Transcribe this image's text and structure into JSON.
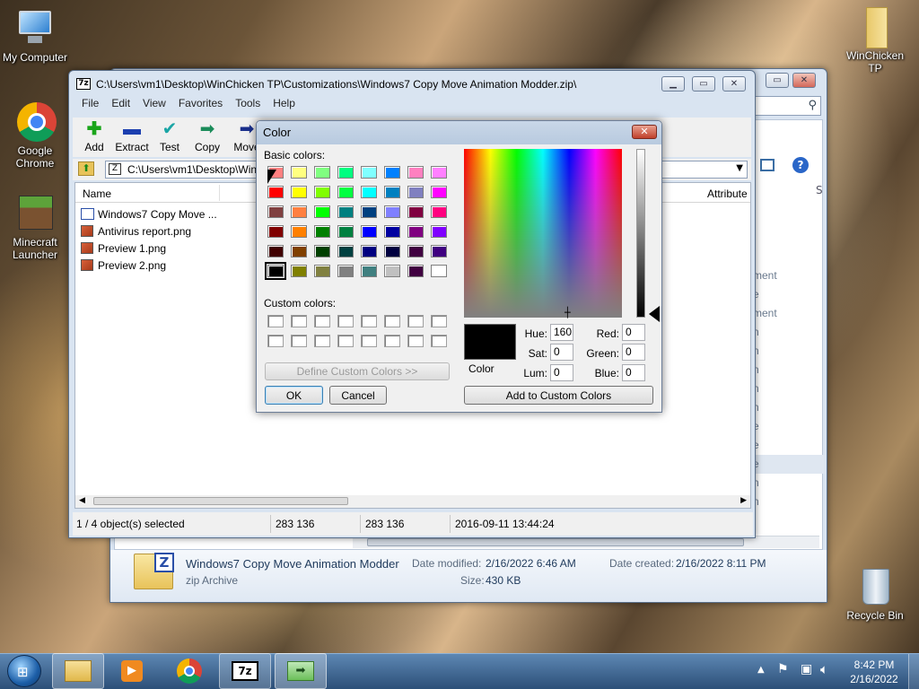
{
  "desktop": {
    "icons": [
      {
        "label": "My Computer",
        "icon": "computer-icon"
      },
      {
        "label": "Google Chrome",
        "icon": "chrome-icon"
      },
      {
        "label": "Minecraft Launcher",
        "icon": "minecraft-icon"
      },
      {
        "label": "WinChicken TP",
        "icon": "folder-zip-icon"
      },
      {
        "label": "Recycle Bin",
        "icon": "recycle-bin-icon"
      }
    ]
  },
  "sevenzip": {
    "title": "C:\\Users\\vm1\\Desktop\\WinChicken TP\\Customizations\\Windows7 Copy Move Animation Modder.zip\\",
    "menu": [
      "File",
      "Edit",
      "View",
      "Favorites",
      "Tools",
      "Help"
    ],
    "toolbar": [
      "Add",
      "Extract",
      "Test",
      "Copy",
      "Move"
    ],
    "address": "C:\\Users\\vm1\\Desktop\\Win",
    "columns": {
      "name": "Name",
      "attributes": "Attribute"
    },
    "files": [
      "Windows7 Copy Move ...",
      "Antivirus report.png",
      "Preview 1.png",
      "Preview 2.png"
    ],
    "status": {
      "selected": "1 / 4 object(s) selected",
      "size": "283 136",
      "packed": "283 136",
      "modified": "2016-09-11 13:44:24"
    }
  },
  "explorer": {
    "side_items": [
      "ment",
      "e",
      "ment",
      "n",
      "n",
      "n",
      "n",
      "n",
      "e",
      "e",
      "e",
      "n",
      "n"
    ],
    "details": {
      "name": "Windows7 Copy Move Animation Modder",
      "type": "zip Archive",
      "modified_label": "Date modified:",
      "modified": "2/16/2022 6:46 AM",
      "created_label": "Date created:",
      "created": "2/16/2022 8:11 PM",
      "size_label": "Size:",
      "size": "430 KB"
    },
    "header_partial": "S"
  },
  "color_dialog": {
    "title": "Color",
    "basic_label": "Basic colors:",
    "custom_label": "Custom colors:",
    "define_button": "Define Custom Colors >>",
    "ok": "OK",
    "cancel": "Cancel",
    "add_button": "Add to Custom Colors",
    "preview_label": "Color",
    "fields": {
      "hue_label": "Hue:",
      "hue": "160",
      "sat_label": "Sat:",
      "sat": "0",
      "lum_label": "Lum:",
      "lum": "0",
      "red_label": "Red:",
      "red": "0",
      "green_label": "Green:",
      "green": "0",
      "blue_label": "Blue:",
      "blue": "0"
    },
    "basic_colors": [
      "#ff8080",
      "#ffff80",
      "#80ff80",
      "#00ff80",
      "#80ffff",
      "#0080ff",
      "#ff80c0",
      "#ff80ff",
      "#ff0000",
      "#ffff00",
      "#80ff00",
      "#00ff40",
      "#00ffff",
      "#0080c0",
      "#8080c0",
      "#ff00ff",
      "#804040",
      "#ff8040",
      "#00ff00",
      "#008080",
      "#004080",
      "#8080ff",
      "#800040",
      "#ff0080",
      "#800000",
      "#ff8000",
      "#008000",
      "#008040",
      "#0000ff",
      "#0000a0",
      "#800080",
      "#8000ff",
      "#400000",
      "#804000",
      "#004000",
      "#004040",
      "#000080",
      "#000040",
      "#400040",
      "#400080",
      "#000000",
      "#808000",
      "#808040",
      "#808080",
      "#408080",
      "#c0c0c0",
      "#400040",
      "#ffffff"
    ]
  },
  "taskbar": {
    "time": "8:42 PM",
    "date": "2/16/2022",
    "apps": [
      "explorer-icon",
      "media-player-icon",
      "chrome-icon",
      "7zip-icon",
      "copy-move-icon"
    ]
  }
}
